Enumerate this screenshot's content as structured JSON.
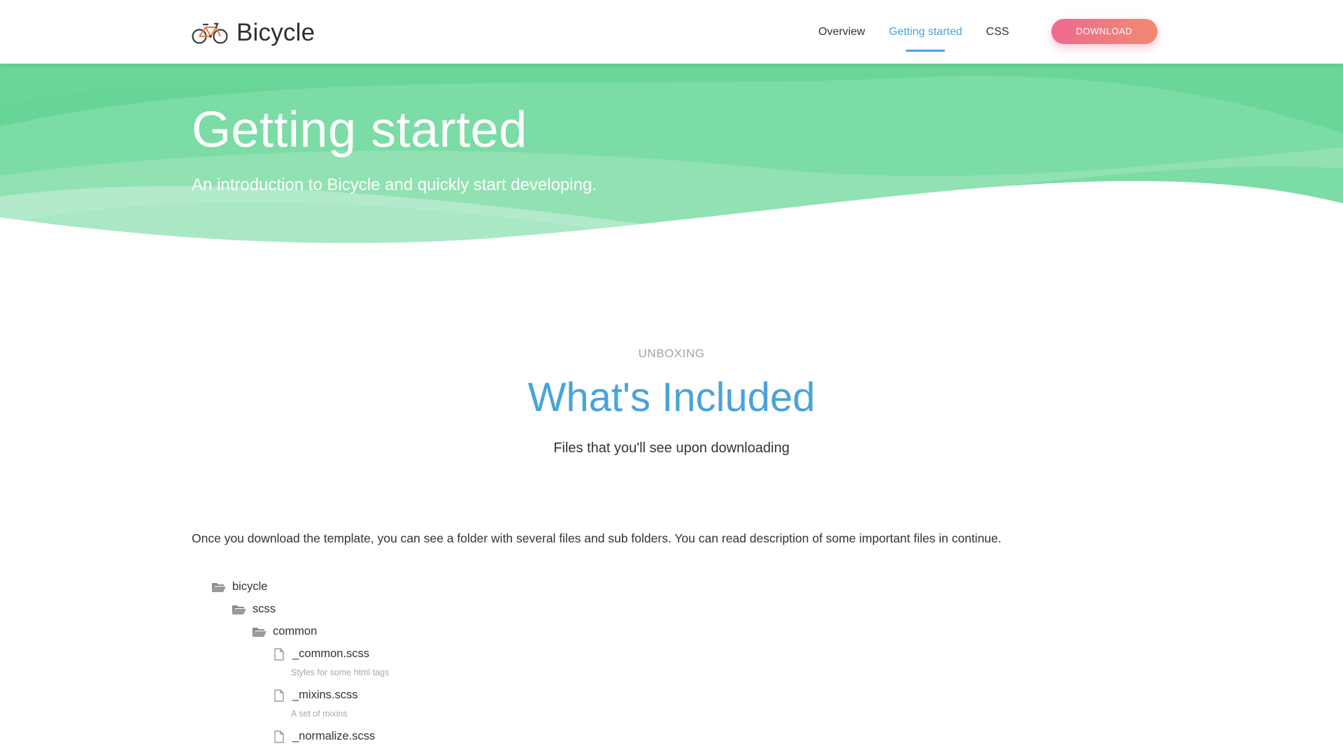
{
  "header": {
    "brand": "Bicycle",
    "nav": [
      "Overview",
      "Getting started",
      "CSS"
    ],
    "active_nav": "Getting started",
    "download_label": "DOWNLOAD"
  },
  "hero": {
    "title": "Getting started",
    "subtitle": "An introduction to Bicycle and quickly start developing."
  },
  "section": {
    "eyebrow": "UNBOXING",
    "title": "What's Included",
    "lead": "Files that you'll see upon downloading",
    "intro": "Once you download the template, you can see a folder with several files and sub folders. You can read description of some important files in continue."
  },
  "tree": {
    "items": [
      {
        "label": "bicycle",
        "kind": "folder"
      },
      {
        "label": "scss",
        "kind": "folder"
      },
      {
        "label": "common",
        "kind": "folder"
      },
      {
        "label": "_common.scss",
        "kind": "file",
        "desc": "Styles for some html tags"
      },
      {
        "label": "_mixins.scss",
        "kind": "file",
        "desc": "A set of mixins"
      },
      {
        "label": "_normalize.scss",
        "kind": "file"
      }
    ]
  },
  "colors": {
    "accent": "#4aa3d8",
    "hero_green": "#66d595",
    "download_start": "#ee6a8f",
    "download_end": "#f28a72"
  },
  "icons": {
    "brand": "bicycle-icon",
    "folder": "folder-open-icon",
    "file": "file-icon"
  }
}
